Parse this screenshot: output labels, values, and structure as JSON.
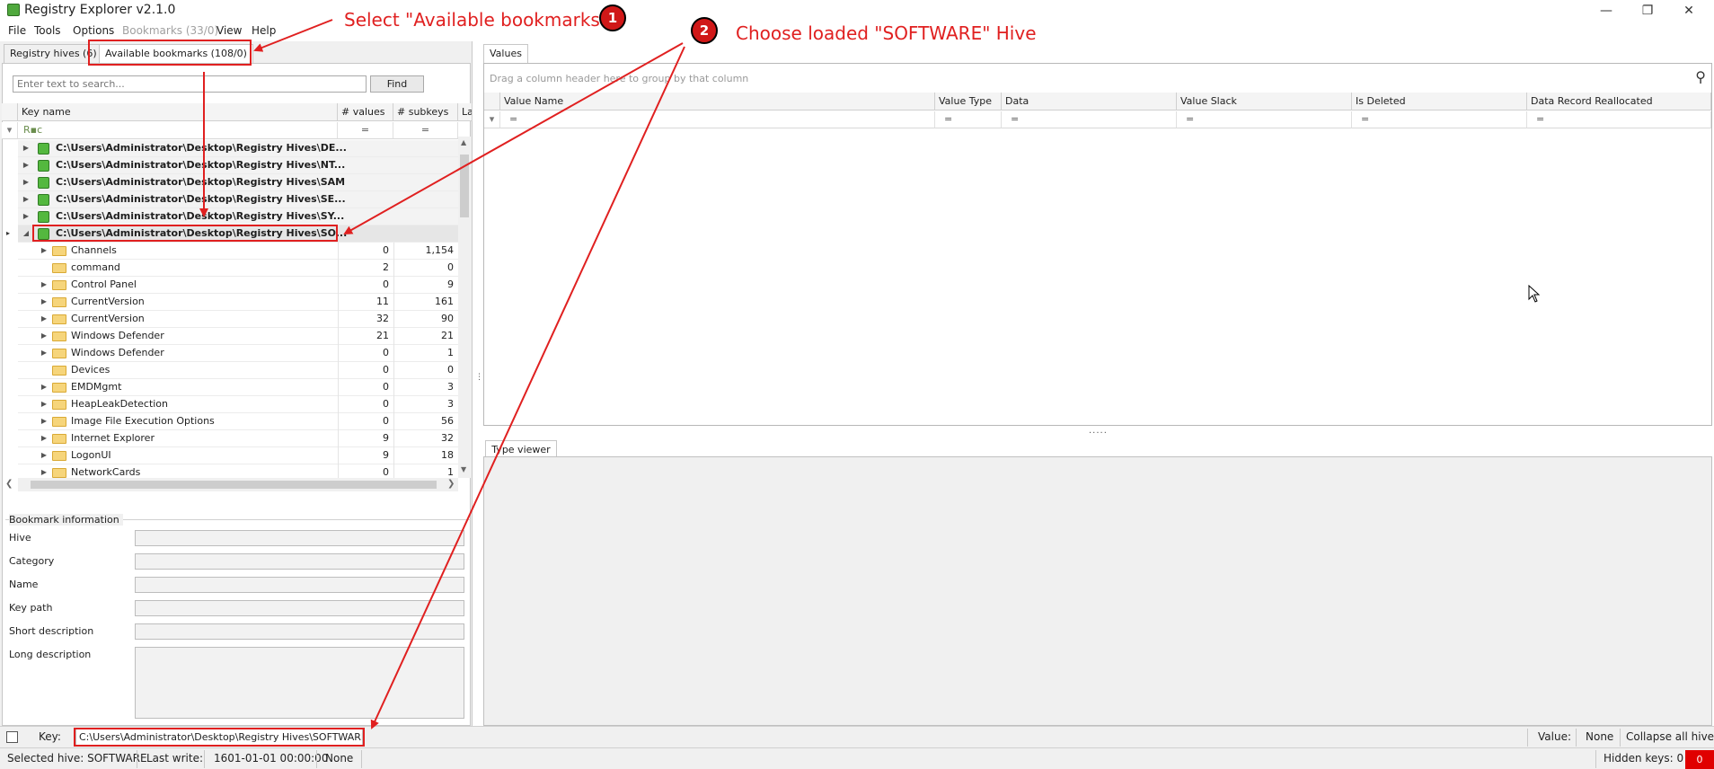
{
  "window": {
    "title": "Registry Explorer v2.1.0"
  },
  "menu": [
    "File",
    "Tools",
    "Options",
    "Bookmarks (33/0)",
    "View",
    "Help"
  ],
  "left": {
    "tabs": [
      "Registry hives (6)",
      "Available bookmarks (108/0)"
    ],
    "search_placeholder": "Enter text to search...",
    "find_label": "Find",
    "columns": [
      "Key name",
      "# values",
      "# subkeys",
      "Las"
    ],
    "filter_glyph": "R▪c",
    "equals": "=",
    "hives": [
      "C:\\Users\\Administrator\\Desktop\\Registry Hives\\DE...",
      "C:\\Users\\Administrator\\Desktop\\Registry Hives\\NT...",
      "C:\\Users\\Administrator\\Desktop\\Registry Hives\\SAM",
      "C:\\Users\\Administrator\\Desktop\\Registry Hives\\SE...",
      "C:\\Users\\Administrator\\Desktop\\Registry Hives\\SY...",
      "C:\\Users\\Administrator\\Desktop\\Registry Hives\\SO..."
    ],
    "keys": [
      {
        "name": "Channels",
        "values": "0",
        "subkeys": "1,154",
        "expandable": true
      },
      {
        "name": "command",
        "values": "2",
        "subkeys": "0",
        "expandable": false
      },
      {
        "name": "Control Panel",
        "values": "0",
        "subkeys": "9",
        "expandable": true
      },
      {
        "name": "CurrentVersion",
        "values": "11",
        "subkeys": "161",
        "expandable": true
      },
      {
        "name": "CurrentVersion",
        "values": "32",
        "subkeys": "90",
        "expandable": true
      },
      {
        "name": "Windows Defender",
        "values": "21",
        "subkeys": "21",
        "expandable": true
      },
      {
        "name": "Windows Defender",
        "values": "0",
        "subkeys": "1",
        "expandable": true
      },
      {
        "name": "Devices",
        "values": "0",
        "subkeys": "0",
        "expandable": false
      },
      {
        "name": "EMDMgmt",
        "values": "0",
        "subkeys": "3",
        "expandable": true
      },
      {
        "name": "HeapLeakDetection",
        "values": "0",
        "subkeys": "3",
        "expandable": true
      },
      {
        "name": "Image File Execution Options",
        "values": "0",
        "subkeys": "56",
        "expandable": true
      },
      {
        "name": "Internet Explorer",
        "values": "9",
        "subkeys": "32",
        "expandable": true
      },
      {
        "name": "LogonUI",
        "values": "9",
        "subkeys": "18",
        "expandable": true
      },
      {
        "name": "NetworkCards",
        "values": "0",
        "subkeys": "1",
        "expandable": true
      }
    ],
    "bookmark_info": {
      "title": "Bookmark information",
      "labels": [
        "Hive",
        "Category",
        "Name",
        "Key path",
        "Short description",
        "Long description"
      ]
    }
  },
  "right": {
    "values_tab": "Values",
    "group_hint": "Drag a column header here to group by that column",
    "columns": [
      "Value Name",
      "Value Type",
      "Data",
      "Value Slack",
      "Is Deleted",
      "Data Record Reallocated"
    ],
    "type_viewer_tab": "Type viewer"
  },
  "keybar": {
    "key_label": "Key:",
    "key_value": "C:\\Users\\Administrator\\Desktop\\Registry Hives\\SOFTWARE",
    "value_label": "Value:",
    "value_value": "None",
    "collapse_label": "Collapse all hives"
  },
  "statusbar": {
    "selected_hive": "Selected hive: SOFTWARE",
    "last_write_label": "Last write:",
    "last_write_value": "1601-01-01 00:00:00",
    "none": "None",
    "hidden_keys": "Hidden keys: 0",
    "alert_count": "0"
  },
  "annotations": {
    "step1_text": "Select \"Available bookmarks\"",
    "step1_num": "1",
    "step2_text": "Choose loaded \"SOFTWARE\" Hive",
    "step2_num": "2",
    "color": "#e02020"
  },
  "colors": {
    "accent_red": "#e02020",
    "hive_green": "#54b83f",
    "folder_yellow": "#f6d57b"
  }
}
